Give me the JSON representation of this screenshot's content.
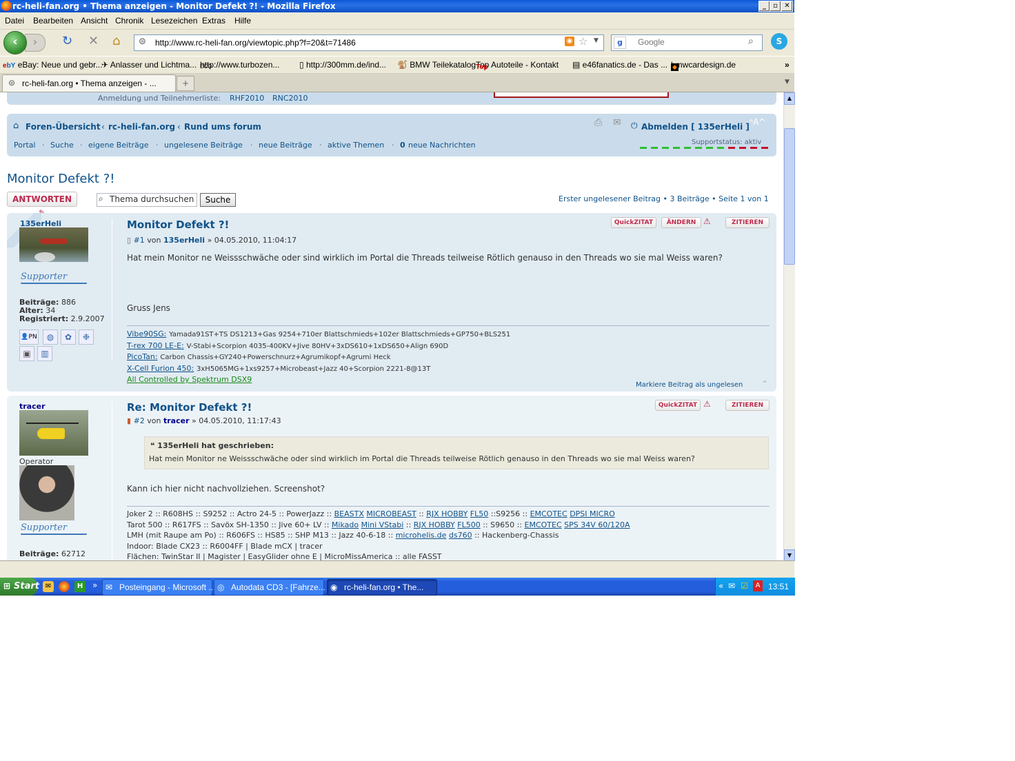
{
  "window": {
    "title": "rc-heli-fan.org • Thema anzeigen - Monitor Defekt ?! - Mozilla Firefox"
  },
  "menu": [
    "Datei",
    "Bearbeiten",
    "Ansicht",
    "Chronik",
    "Lesezeichen",
    "Extras",
    "Hilfe"
  ],
  "nav": {
    "url": "http://www.rc-heli-fan.org/viewtopic.php?f=20&t=71486",
    "search_placeholder": "Google"
  },
  "bookmarks": [
    "eBay: Neue und gebr...",
    "Anlasser und Lichtma...",
    "http://www.turbozen...",
    "http://300mm.de/ind...",
    "BMW Teilekatalog",
    "Top Autoteile - Kontakt",
    "e46fanatics.de - Das ...",
    "bmwcardesign.de"
  ],
  "tab": {
    "label": "rc-heli-fan.org • Thema anzeigen - ..."
  },
  "top": {
    "registration_label": "Anmeldung und Teilnehmerliste:",
    "rhf": "RHF2010",
    "rnc": "RNC2010"
  },
  "breadcrumb": {
    "home": "Foren-Übersicht",
    "sep": "‹",
    "forum": "rc-heli-fan.org",
    "sub": "Rund ums forum",
    "logout": "Abmelden [ 135erHeli ]"
  },
  "links": {
    "portal": "Portal",
    "search": "Suche",
    "own": "eigene Beiträge",
    "unread": "ungelesene Beiträge",
    "new": "neue Beiträge",
    "active": "aktive Themen",
    "messages_count": "0",
    "messages": "neue Nachrichten",
    "support_status": "Supportstatus: aktiv"
  },
  "topic": {
    "title": "Monitor Defekt ?!",
    "reply": "ANTWORTEN",
    "search_placeholder": "Thema durchsuchen",
    "search_btn": "Suche",
    "pagination": "Erster ungelesener Beitrag • 3 Beiträge • Seite 1 von 1"
  },
  "post1": {
    "author": "135erHeli",
    "stats": {
      "posts_label": "Beiträge:",
      "posts": "886",
      "age_label": "Alter:",
      "age": "34",
      "reg_label": "Registriert:",
      "reg": "2.9.2007"
    },
    "title": "Monitor Defekt ?!",
    "meta_num": "#1",
    "meta_von": "von",
    "meta_date": "» 04.05.2010, 11:04:17",
    "body": "Hat mein Monitor ne Weissschwäche oder sind wirklich im Portal die Threads teilweise Rötlich genauso in den Threads wo sie mal Weiss waren?",
    "greeting": "Gruss Jens",
    "sig": [
      {
        "name": "Vibe90SG:",
        "text": "Yamada91ST+TS DS1213+Gas 9254+710er Blattschmieds+102er Blattschmieds+GP750+BLS251"
      },
      {
        "name": "T-rex 700 LE-E:",
        "text": "V-Stabi+Scorpion 4035-400KV+Jive 80HV+3xDS610+1xDS650+Align 690D"
      },
      {
        "name": "PicoTan:",
        "text": "Carbon Chassis+GY240+Powerschnurz+Agrumikopf+Agrumi Heck"
      },
      {
        "name": "X-Cell Furion 450:",
        "text": "3xH5065MG+1xs9257+Microbeast+Jazz 40+Scorpion 2221-8@13T"
      }
    ],
    "sig_last": "All Controlled by Spektrum DSX9",
    "mark_unread": "Markiere Beitrag als ungelesen",
    "btn_quick": "QuickZITAT",
    "btn_edit": "ÄNDERN",
    "btn_quote": "ZITIEREN",
    "supporter": "Supporter"
  },
  "post2": {
    "author": "tracer",
    "rank": "Operator",
    "stats": {
      "posts_label": "Beiträge:",
      "posts": "62712"
    },
    "title": "Re: Monitor Defekt ?!",
    "meta_num": "#2",
    "meta_von": "von",
    "meta_date": "» 04.05.2010, 11:17:43",
    "quote_author": "135erHeli hat geschrieben:",
    "quote_text": "Hat mein Monitor ne Weissschwäche oder sind wirklich im Portal die Threads teilweise Rötlich genauso in den Threads wo sie mal Weiss waren?",
    "body": "Kann ich hier nicht nachvollziehen. Screenshot?",
    "sig_lines": [
      "Joker 2 :: R608HS :: S9252 :: Actro 24-5 :: PowerJazz ::",
      "Tarot 500 :: R617FS :: Savöx SH-1350 :: Jive 60+ LV ::",
      "LMH (mit Raupe am Po) :: R606FS :: HS85 :: SHP M13 :: Jazz 40-6-18 ::",
      "Indoor: Blade CX23 :: R6004FF | Blade mCX | tracer",
      "Flächen: TwinStar II | Magister | EasyGlider ohne E | MicroMissAmerica :: alle FASST"
    ],
    "sig_links_1": [
      "BEASTX",
      "MICROBEAST",
      "::",
      "RJX HOBBY",
      "FL50",
      "::S9256 ::",
      "EMCOTEC",
      "DPSI MICRO"
    ],
    "sig_links_2": [
      "Mikado",
      "Mini VStabi",
      "::",
      "RJX HOBBY",
      "FL500",
      ":: S9650 ::",
      "EMCOTEC",
      "SPS 34V 60/120A"
    ],
    "sig_links_3": [
      "microhelis.de",
      "ds760",
      ":: Hackenberg-Chassis"
    ],
    "btn_quick": "QuickZITAT",
    "btn_quote": "ZITIEREN",
    "supporter": "Supporter"
  },
  "taskbar": {
    "start": "Start",
    "items": [
      "Posteingang - Microsoft ...",
      "Autodata CD3 - [Fahrze...",
      "rc-heli-fan.org • The..."
    ],
    "time": "13:51"
  }
}
